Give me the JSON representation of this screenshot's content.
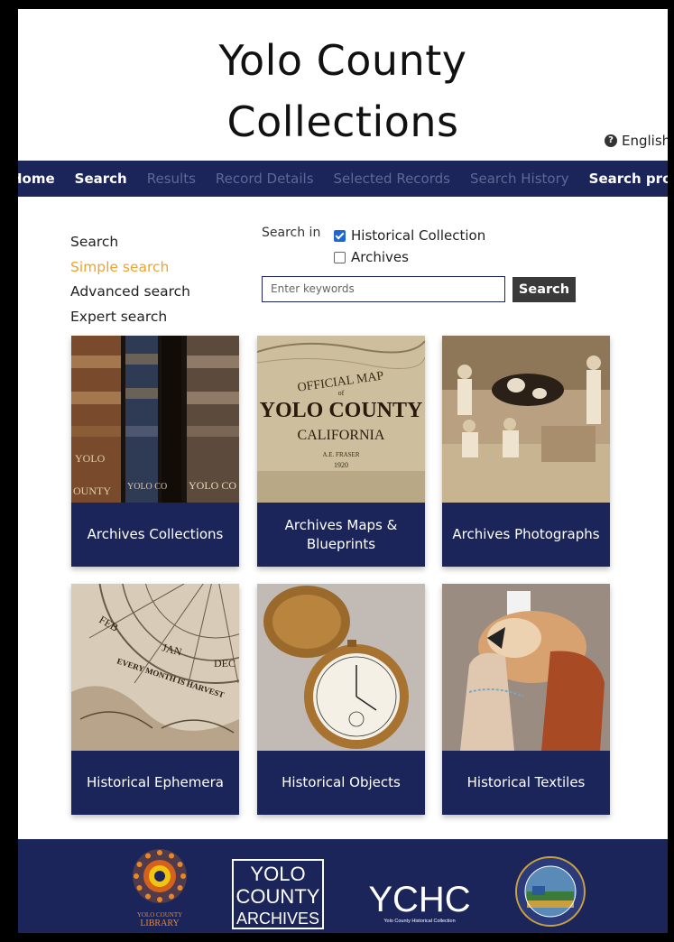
{
  "header": {
    "title_line1": "Yolo County",
    "title_line2": "Collections",
    "language": "English"
  },
  "nav": {
    "items": [
      {
        "label": "Home",
        "state": "enabled"
      },
      {
        "label": "Search",
        "state": "enabled"
      },
      {
        "label": "Results",
        "state": "disabled"
      },
      {
        "label": "Record Details",
        "state": "disabled"
      },
      {
        "label": "Selected Records",
        "state": "disabled"
      },
      {
        "label": "Search History",
        "state": "disabled"
      },
      {
        "label": "Search profiles",
        "state": "enabled"
      }
    ]
  },
  "side_menu": {
    "heading": "Search",
    "items": [
      {
        "label": "Simple search",
        "active": true
      },
      {
        "label": "Advanced search",
        "active": false
      },
      {
        "label": "Expert search",
        "active": false
      }
    ]
  },
  "search": {
    "search_in_label": "Search in",
    "options": [
      {
        "label": "Historical Collection",
        "checked": true
      },
      {
        "label": "Archives",
        "checked": false
      }
    ],
    "placeholder": "Enter keywords",
    "button_label": "Search"
  },
  "cards": [
    {
      "label": "Archives Collections",
      "image": "old-book-spines"
    },
    {
      "label": "Archives Maps & Blueprints",
      "image": "official-map-yolo-county"
    },
    {
      "label": "Archives Photographs",
      "image": "sepia-photo-cows"
    },
    {
      "label": "Historical Ephemera",
      "image": "calendar-wheel"
    },
    {
      "label": "Historical Objects",
      "image": "pocket-watch"
    },
    {
      "label": "Historical Textiles",
      "image": "fur-stole"
    }
  ],
  "map_image_text": {
    "line1": "OFFICIAL MAP",
    "line2": "of",
    "line3": "YOLO COUNTY",
    "line4": "CALIFORNIA",
    "line5": "A.E. FRASER",
    "line6": "1920"
  },
  "book_spine_text": {
    "spine1a": "YOLO",
    "spine1b": "OUNTY",
    "spine2": "YOLO CO",
    "spine3": "YOLO CO"
  },
  "calendar_text": {
    "feb": "FEB",
    "jan": "JAN",
    "dec": "DEC",
    "motto": "EVERY MONTH IS HARVEST"
  },
  "footer": {
    "logos": [
      {
        "line1": "YOLO COUNTY",
        "line2": "LIBRARY"
      },
      {
        "line1": "YOLO",
        "line2": "COUNTY",
        "line3": "ARCHIVES"
      },
      {
        "line1": "YCHC",
        "line2": "Yolo County Historical Collection"
      },
      {
        "name": "county-seal"
      }
    ]
  },
  "colors": {
    "navy": "#1c2559",
    "accent_orange": "#f0a32a",
    "nav_disabled": "#5d6996"
  }
}
